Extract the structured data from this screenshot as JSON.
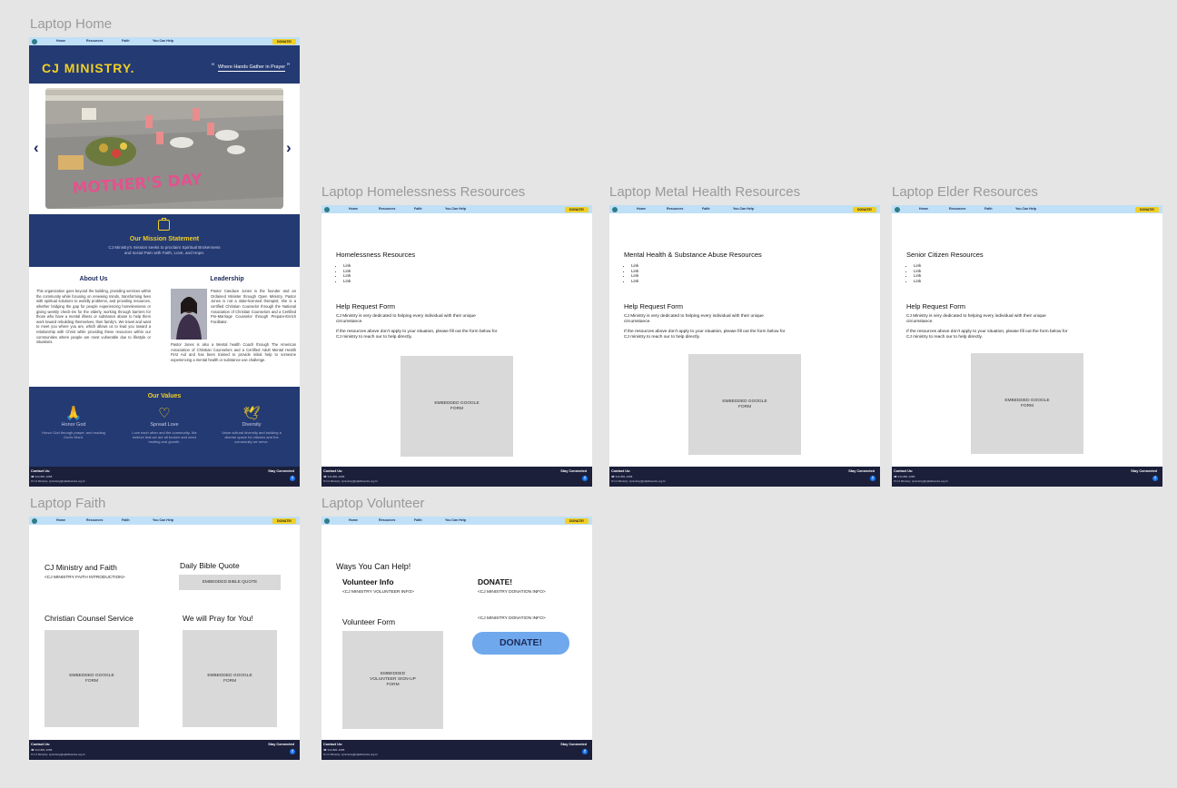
{
  "frames": {
    "home": "Laptop Home",
    "homeless": "Laptop Homelessness Resources",
    "mental": "Laptop Metal Health Resources",
    "elder": "Laptop Elder Resources",
    "faith": "Laptop Faith",
    "volunteer": "Laptop Volunteer"
  },
  "nav": {
    "home": "Home",
    "resources": "Resources",
    "faith": "Faith",
    "help": "You Can Help",
    "donate": "DONATE!"
  },
  "footer": {
    "contact": "Contact Us:",
    "phone": "913-881-1088",
    "email": "CJ Ministry: cjministry@cjfaithworks.org.hr",
    "stay": "Stay Connected",
    "fb": "f"
  },
  "home": {
    "brand": "CJ MINISTRY.",
    "tagline": "Where Hands Gather in Prayer",
    "photo_text": "MOTHER'S DAY",
    "mission_title": "Our Mission Statement",
    "mission_text": "CJ Ministry's mission seeks to proclaim Spiritual Brokenness and social Pain with Faith, Love, and Hope.",
    "about_title": "About Us",
    "about_text": "This organization goes beyond the building, providing services within the community while focusing on renewing minds, transforming lives with spiritual solutions to worldly problems, and providing resources, whether bridging the gap for people experiencing homelessness or giving weekly check-ins for the elderly, working through barriers for those who have a mental illness or substance abuse to help them work toward rebuilding themselves, their family's. We travel and want to meet you where you are, which allows us to lead you toward a relationship with Christ while providing these resources within our communities where people are most vulnerable due to lifestyle or situations.",
    "leader_title": "Leadership",
    "leader_text_1": "Pastor Candace Jones is the founder and an Ordained Minister through Open Ministry. Pastor Jones is not a state-licensed therapist; she is a certified Christian Counselor through the National Association of Christian Counselors and a Certified Pre-Marriage Counselor through Prepare-Enrich Facilitator.",
    "leader_text_2": "Pastor Jones is also a Mental health Coach through The American Association of Christian Counselors and a Certified Adult Mental Health First Aid and has been trained to provide initial help to someone experiencing a mental health or substance use challenge.",
    "values_title": "Our Values",
    "values": [
      {
        "icon": "praying-hands-icon",
        "glyph": "🙏",
        "title": "Honor God",
        "desc": "Honor God through prayer, and reading God's Word."
      },
      {
        "icon": "heart-icon",
        "glyph": "♡",
        "title": "Spread Love",
        "desc": "Love each other and the community. We believe that we are all broken and need healing and growth."
      },
      {
        "icon": "dove-icon",
        "glyph": "🕊",
        "title": "Diversity",
        "desc": "Value cultural diversity and building a diverse space for citizens and the community we serve."
      }
    ]
  },
  "resources": {
    "homeless_title": "Homelessness Resources",
    "mental_title": "Mental Health & Substance Abuse Resources",
    "elder_title": "Senior Citizen Resources",
    "links": [
      "Link",
      "Link",
      "Link",
      "Link"
    ],
    "form_title": "Help Request Form",
    "form_text_1": "CJ Ministry is very dedicated to helping every individual with their unique circumstance.",
    "form_text_2": "If the resources above don't apply to your situation, please fill out the form below for CJ ministry to reach our to help directly.",
    "embed": "EMBEDDED GOOGLE\nFORM"
  },
  "faith": {
    "title": "CJ Ministry and Faith",
    "intro": "<CJ MINISTRY FAITH INTRODUCTION>",
    "quote_title": "Daily Bible Quote",
    "quote_box": "EMBEDDED BIBLE QUOTE",
    "counsel_title": "Christian Counsel Service",
    "pray_title": "We will Pray for You!",
    "embed": "EMBEDDED GOOGLE\nFORM"
  },
  "volunteer": {
    "title": "Ways You Can Help!",
    "info_title": "Volunteer Info",
    "info_text": "<CJ MINISTRY VOLUNTEER INFO>",
    "donate_title": "DONATE!",
    "donate_text": "<CJ MINISTRY DONATION INFO>",
    "form_title": "Volunteer Form",
    "donate_text_2": "<CJ MINISTRY DONATION INFO>",
    "embed": "EMBEDDED\nVOLUNTEER SIGN-UP\nFORM",
    "donate_btn": "DONATE!"
  }
}
